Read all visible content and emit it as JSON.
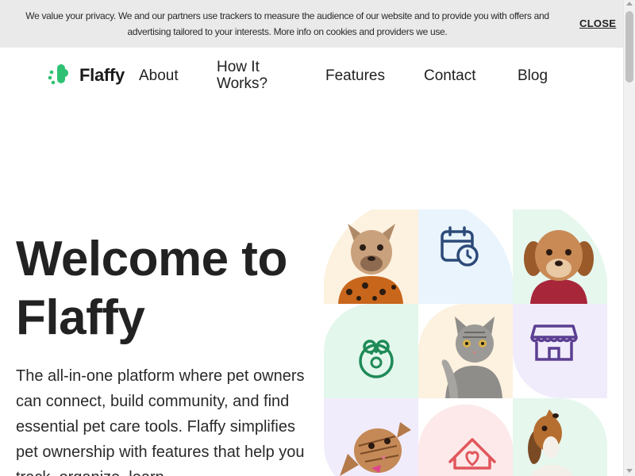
{
  "cookie": {
    "text": "We value your privacy. We and our partners use trackers to measure the audience of our website and to provide you with offers and advertising tailored to your interests. More info on cookies and providers we use.",
    "close_label": "CLOSE"
  },
  "brand": {
    "name": "Flaffy",
    "accent": "#2fc173"
  },
  "nav": {
    "items": [
      {
        "label": "About"
      },
      {
        "label": "How It Works?"
      },
      {
        "label": "Features"
      },
      {
        "label": "Contact"
      },
      {
        "label": "Blog"
      }
    ]
  },
  "hero": {
    "title": "Welcome to Flaffy",
    "description": "The all-in-one platform where pet owners can connect, build community, and find essential pet care tools. Flaffy simplifies pet ownership with features that help you track, organize, learn"
  },
  "grid": {
    "tiles": [
      {
        "kind": "photo",
        "subject": "french-bulldog",
        "bg": "#fdf1df"
      },
      {
        "kind": "icon",
        "icon": "calendar-clock-icon",
        "bg": "#e9f4fd",
        "color": "#2c4a78"
      },
      {
        "kind": "photo",
        "subject": "shih-tzu",
        "bg": "#e6f7ee"
      },
      {
        "kind": "icon",
        "icon": "paw-badge-icon",
        "bg": "#e3f7ec",
        "color": "#1f8a58"
      },
      {
        "kind": "photo",
        "subject": "tabby-cat",
        "bg": "#fdf1df"
      },
      {
        "kind": "icon",
        "icon": "store-icon",
        "bg": "#f1ecfb",
        "color": "#5b3f92"
      },
      {
        "kind": "photo",
        "subject": "kitten",
        "bg": "#f1ecfb"
      },
      {
        "kind": "icon",
        "icon": "home-heart-icon",
        "bg": "#fde9e9",
        "color": "#e0575c"
      },
      {
        "kind": "photo",
        "subject": "beagle",
        "bg": "#e6f7ee"
      }
    ]
  }
}
